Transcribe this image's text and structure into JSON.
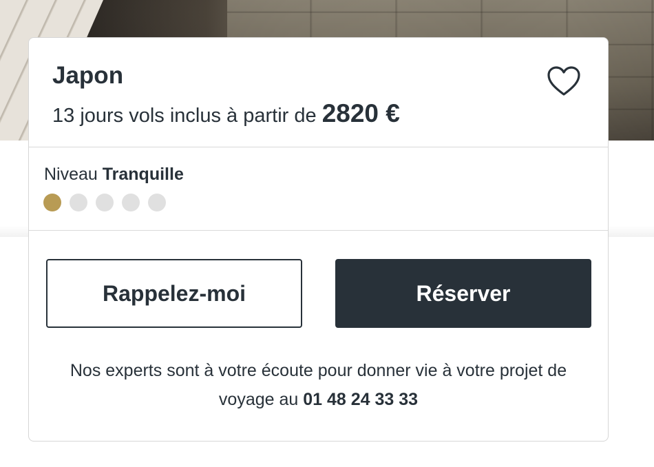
{
  "card": {
    "title": "Japon",
    "subtitle_text": "13 jours vols inclus à partir de ",
    "price": "2820 €",
    "favorite_icon": "heart-outline-icon"
  },
  "level": {
    "prefix": "Niveau ",
    "value": "Tranquille",
    "rating": 1,
    "max": 5,
    "active_color": "#b89b54",
    "inactive_color": "#e0e0e0"
  },
  "actions": {
    "callback_label": "Rappelez-moi",
    "book_label": "Réserver"
  },
  "info": {
    "text": "Nos experts sont à votre écoute pour donner vie à votre projet de voyage au ",
    "phone": "01 48 24 33 33"
  },
  "colors": {
    "primary": "#283139",
    "accent": "#b89b54"
  }
}
